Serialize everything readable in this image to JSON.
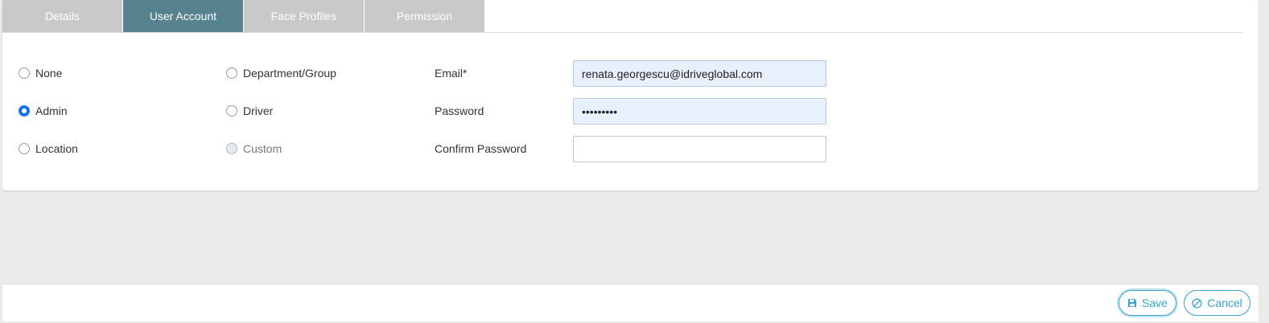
{
  "tabs": [
    {
      "label": "Details",
      "active": false
    },
    {
      "label": "User Account",
      "active": true
    },
    {
      "label": "Face Profiles",
      "active": false
    },
    {
      "label": "Permission",
      "active": false
    }
  ],
  "roles": {
    "none": {
      "label": "None",
      "checked": false
    },
    "department_group": {
      "label": "Department/Group",
      "checked": false
    },
    "admin": {
      "label": "Admin",
      "checked": true
    },
    "driver": {
      "label": "Driver",
      "checked": false
    },
    "location": {
      "label": "Location",
      "checked": false
    },
    "custom": {
      "label": "Custom",
      "checked": false,
      "disabled": true
    }
  },
  "form": {
    "email_label": "Email*",
    "email_value": "renata.georgescu@idriveglobal.com",
    "password_label": "Password",
    "password_value": "•••••••••",
    "confirm_password_label": "Confirm Password",
    "confirm_password_value": ""
  },
  "footer": {
    "save_label": "Save",
    "cancel_label": "Cancel"
  },
  "colors": {
    "tab_active": "#57838f",
    "tab_inactive": "#c9c9c9",
    "accent": "#3da3c9",
    "radio_checked": "#1a73e8",
    "autofill_bg": "#e8f0fe"
  }
}
